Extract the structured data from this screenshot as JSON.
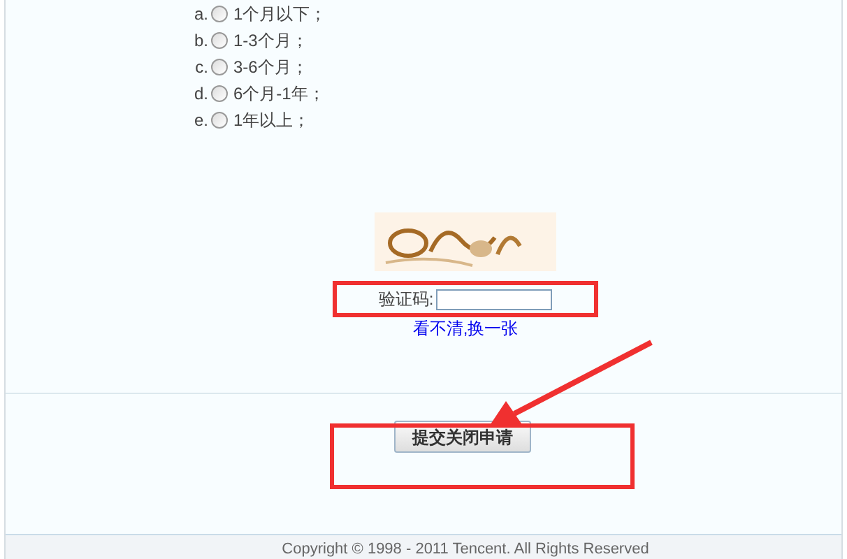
{
  "options": [
    {
      "marker": "a.",
      "label": "1个月以下；",
      "selected": false
    },
    {
      "marker": "b.",
      "label": "1-3个月；",
      "selected": false
    },
    {
      "marker": "c.",
      "label": "3-6个月；",
      "selected": false
    },
    {
      "marker": "d.",
      "label": "6个月-1年；",
      "selected": false
    },
    {
      "marker": "e.",
      "label": "1年以上；",
      "selected": false
    }
  ],
  "captcha": {
    "label": "验证码:",
    "refresh_link": "看不清,换一张"
  },
  "submit_button": "提交关闭申请",
  "footer": "Copyright © 1998 - 2011 Tencent. All Rights Reserved"
}
